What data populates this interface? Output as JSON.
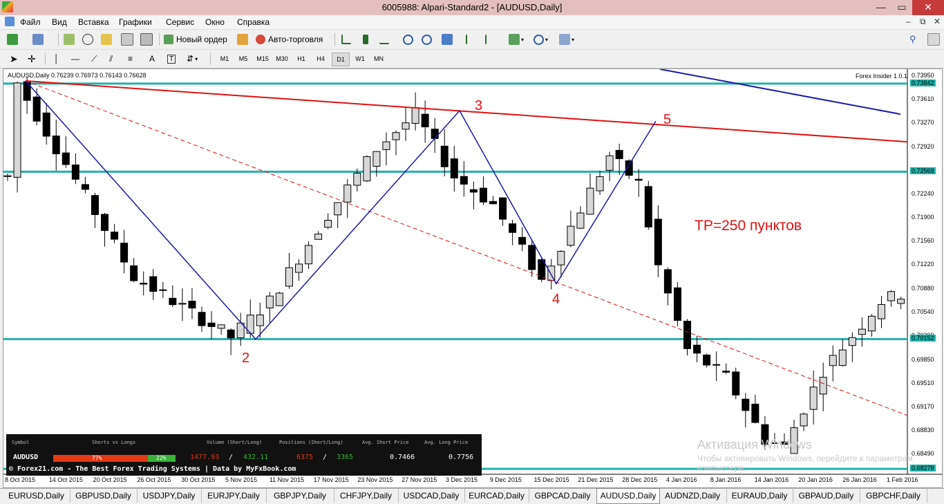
{
  "window": {
    "title": "6005988: Alpari-Standard2 - [AUDUSD,Daily]",
    "controls": {
      "minimize": "—",
      "maximize": "□",
      "close": "✕",
      "restore": "▭",
      "child_minimize": "–",
      "child_restore": "⧉",
      "child_close": "✕"
    }
  },
  "menu": [
    "Файл",
    "Вид",
    "Вставка",
    "Графики",
    "Сервис",
    "Окно",
    "Справка"
  ],
  "toolbar": {
    "new_order": "Новый ордер",
    "auto_trading": "Авто-торговля"
  },
  "timeframes": [
    "M1",
    "M5",
    "M15",
    "M30",
    "H1",
    "H4",
    "D1",
    "W1",
    "MN"
  ],
  "active_timeframe": "D1",
  "chart": {
    "info": "AUDUSD,Daily  0.76239 0.76973 0.76143 0.76628",
    "indicator": "Forex Insider 1.0.1",
    "points": [
      "2",
      "3",
      "4",
      "5"
    ],
    "tp": "TP=250 пунктов",
    "watermark": {
      "title": "Активация Windows",
      "text": "Чтобы активировать Windows, перейдите к параметрам компьютера."
    }
  },
  "chart_data": {
    "type": "candlestick",
    "symbol": "AUDUSD",
    "timeframe": "Daily",
    "ylim": [
      0.682,
      0.7405
    ],
    "price_ticks": [
      "0.73950",
      "0.73610",
      "0.73270",
      "0.72920",
      "0.72580",
      "0.72240",
      "0.71900",
      "0.71560",
      "0.71220",
      "0.70880",
      "0.70540",
      "0.70200",
      "0.69850",
      "0.69510",
      "0.69170",
      "0.68830",
      "0.68490"
    ],
    "hline_labels": [
      "0.73842",
      "0.72569",
      "0.70152",
      "0.68278"
    ],
    "date_ticks": [
      "8 Oct 2015",
      "14 Oct 2015",
      "20 Oct 2015",
      "26 Oct 2015",
      "30 Oct 2015",
      "5 Nov 2015",
      "11 Nov 2015",
      "17 Nov 2015",
      "23 Nov 2015",
      "27 Nov 2015",
      "3 Dec 2015",
      "9 Dec 2015",
      "15 Dec 2015",
      "21 Dec 2015",
      "28 Dec 2015",
      "4 Jan 2016",
      "8 Jan 2016",
      "14 Jan 2016",
      "20 Jan 2016",
      "26 Jan 2016",
      "1 Feb 2016"
    ]
  },
  "signals": {
    "headers": {
      "symbol": "Symbol",
      "sl": "Shorts vs Longs",
      "vol": "Volume (Short/Long)",
      "pos": "Positions (Short/Long)",
      "asp": "Avg. Short Price",
      "alp": "Avg. Long Price"
    },
    "symbol": "AUDUSD",
    "short_pct": "77%",
    "long_pct": "22%",
    "vol_short": "1477.93",
    "vol_long": "432.11",
    "pos_short": "6375",
    "pos_long": "3365",
    "avg_short": "0.7466",
    "avg_long": "0.7756",
    "slash": "/",
    "footer": "© Forex21.com - The Best Forex Trading Systems | Data by MyFxBook.com"
  },
  "tabs": [
    "EURUSD,Daily",
    "GBPUSD,Daily",
    "USDJPY,Daily",
    "EURJPY,Daily",
    "GBPJPY,Daily",
    "CHFJPY,Daily",
    "USDCAD,Daily",
    "EURCAD,Daily",
    "GBPCAD,Daily",
    "AUDUSD,Daily",
    "AUDNZD,Daily",
    "EURAUD,Daily",
    "GBPAUD,Daily",
    "GBPCHF,Daily"
  ],
  "active_tab": "AUDUSD,Daily"
}
